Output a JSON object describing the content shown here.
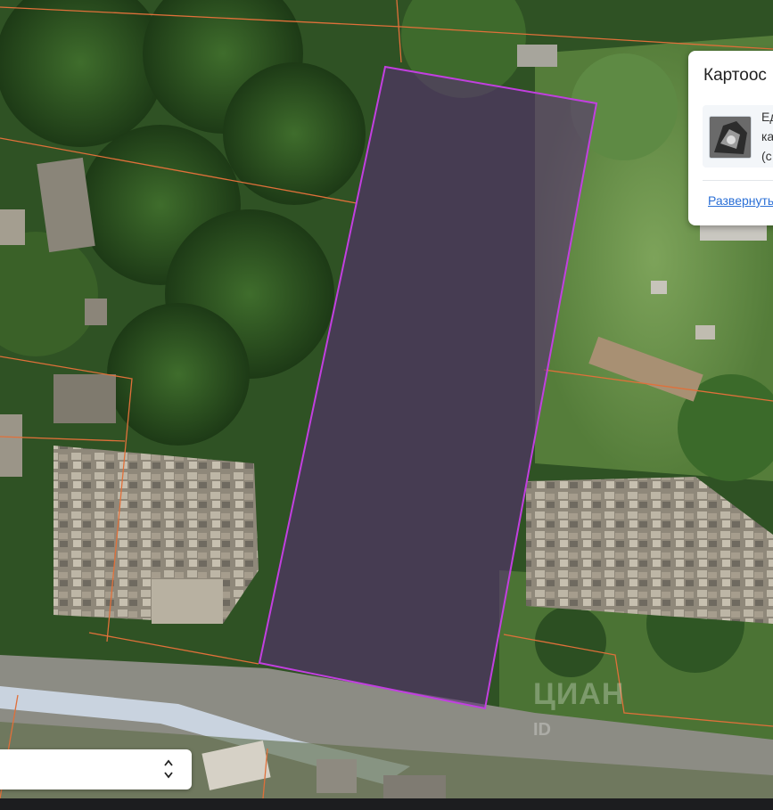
{
  "card": {
    "title": "Картоос",
    "lines": [
      "Ед",
      "ка",
      "(с"
    ],
    "expand_link": "Развернуть"
  },
  "select": {
    "value": ""
  },
  "watermark": {
    "brand": "ЦИАН",
    "id_text": "ID"
  },
  "map": {
    "parcel_color": "#c23fe0",
    "cadastre_line_color": "#e0703a",
    "road_color": "#8c8c84"
  },
  "icons": {
    "select_arrows": "chevron-up-down-icon",
    "thumbnail": "map-thumbnail-icon"
  }
}
